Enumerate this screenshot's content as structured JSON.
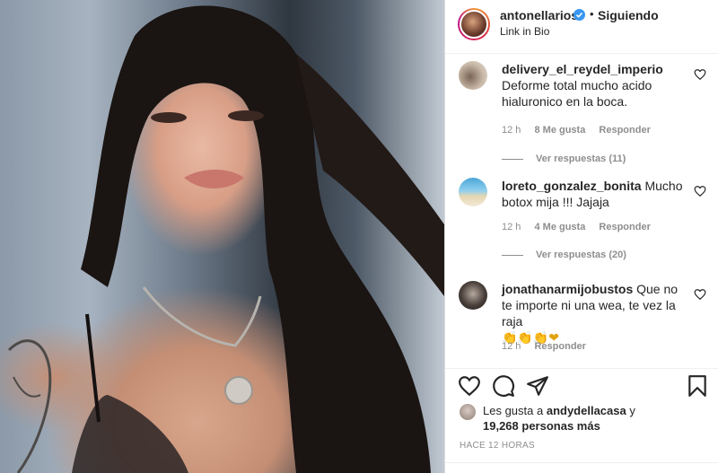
{
  "post": {
    "username": "antonellarios",
    "dot": "•",
    "follow_label": "Siguiendo",
    "subtitle": "Link in Bio"
  },
  "comments": [
    {
      "username": "delivery_el_reydel_imperio",
      "text": "Deforme total mucho acido hialuronico en la boca.",
      "time": "12 h",
      "likes": "8 Me gusta",
      "reply": "Responder",
      "view_replies": "Ver respuestas (11)",
      "avatar": "avatar-dog-icon"
    },
    {
      "username": "loreto_gonzalez_bonita",
      "text": "Mucho botox mija !!! Jajaja",
      "time": "12 h",
      "likes": "4 Me gusta",
      "reply": "Responder",
      "view_replies": "Ver respuestas (20)",
      "avatar": "avatar-beach-icon"
    },
    {
      "username": "jonathanarmijobustos",
      "text": "Que no te importe ni una wea, te vez la raja",
      "emoji": "👏👏👏❤",
      "time": "12 h",
      "reply": "Responder",
      "avatar": "avatar-man-icon"
    }
  ],
  "actions": [
    "heart-icon",
    "comment-icon",
    "share-icon",
    "bookmark-icon"
  ],
  "liked_by": {
    "prefix": "Les gusta a",
    "user": "andydellacasa",
    "suffix": "y",
    "count": "19,268 personas más"
  },
  "timestamp": "HACE 12 HORAS",
  "colors": {
    "verified": "#3897f0",
    "meta_text": "#8e8e8e",
    "primary_text": "#262626"
  }
}
